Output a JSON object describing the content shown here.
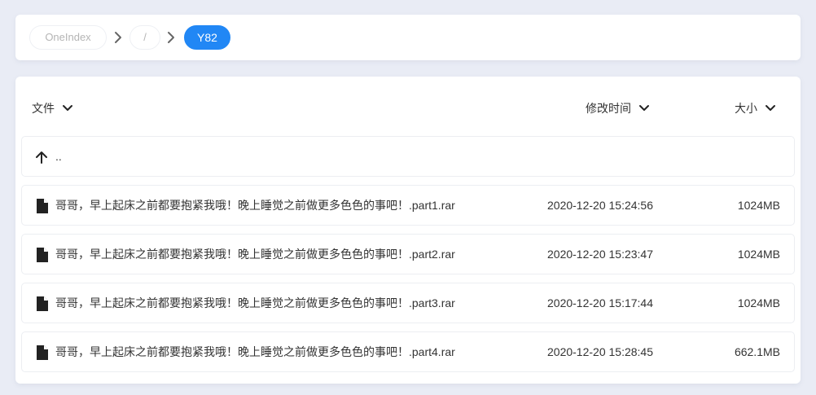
{
  "breadcrumb": {
    "items": [
      {
        "label": "OneIndex"
      },
      {
        "label": "/"
      },
      {
        "label": "Y82"
      }
    ],
    "separator_icon": "chevron-right-icon"
  },
  "list": {
    "headers": {
      "file": "文件",
      "modified": "修改时间",
      "size": "大小"
    },
    "parent": {
      "label": ".."
    },
    "files": [
      {
        "name": "哥哥，早上起床之前都要抱紧我哦！晚上睡觉之前做更多色色的事吧！.part1.rar",
        "modified": "2020-12-20 15:24:56",
        "size": "1024MB"
      },
      {
        "name": "哥哥，早上起床之前都要抱紧我哦！晚上睡觉之前做更多色色的事吧！.part2.rar",
        "modified": "2020-12-20 15:23:47",
        "size": "1024MB"
      },
      {
        "name": "哥哥，早上起床之前都要抱紧我哦！晚上睡觉之前做更多色色的事吧！.part3.rar",
        "modified": "2020-12-20 15:17:44",
        "size": "1024MB"
      },
      {
        "name": "哥哥，早上起床之前都要抱紧我哦！晚上睡觉之前做更多色色的事吧！.part4.rar",
        "modified": "2020-12-20 15:28:45",
        "size": "662.1MB"
      }
    ]
  },
  "colors": {
    "accent": "#2187f5",
    "background": "#e9ecf5"
  }
}
